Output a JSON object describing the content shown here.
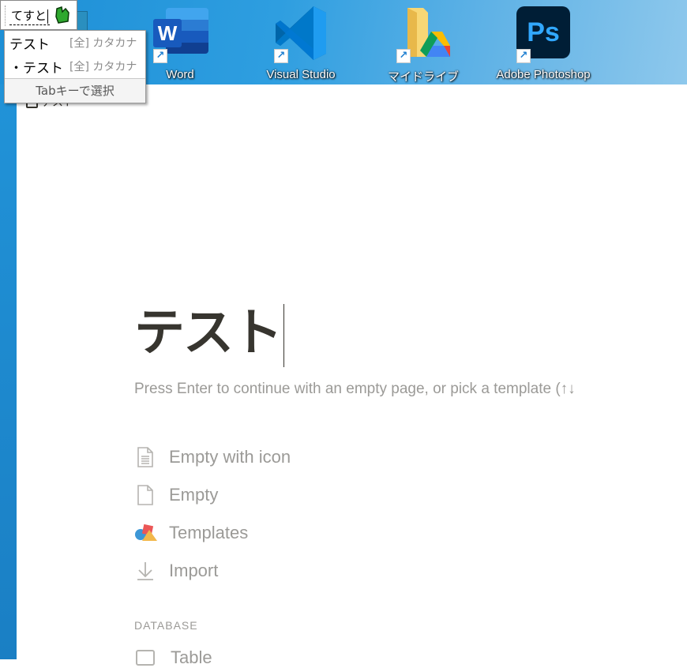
{
  "desktop": {
    "icons": [
      {
        "name": "word",
        "label": "Word",
        "glyph": "W"
      },
      {
        "name": "visual-studio",
        "label": "Visual Studio"
      },
      {
        "name": "my-drive",
        "label": "マイドライブ"
      },
      {
        "name": "adobe-photoshop",
        "label": "Adobe Photoshop",
        "glyph": "Ps"
      }
    ],
    "shortcut_arrow": "↗"
  },
  "ime": {
    "composition": "てすと",
    "candidates": [
      {
        "text": "テスト",
        "meta": "[全] カタカナ"
      },
      {
        "text": "・テスト",
        "meta": "[全] カタカナ"
      }
    ],
    "footer": "Tabキーで選択"
  },
  "page": {
    "breadcrumb": "テスト",
    "breadcrumb_icon": "N",
    "title": "テスト",
    "hint": "Press Enter to continue with an empty page, or pick a template (↑↓",
    "options": [
      {
        "label": "Empty with icon",
        "icon": "page-lines-icon"
      },
      {
        "label": "Empty",
        "icon": "page-icon"
      },
      {
        "label": "Templates",
        "icon": "shapes-icon"
      },
      {
        "label": "Import",
        "icon": "download-icon"
      }
    ],
    "database_label": "DATABASE",
    "database_items": [
      {
        "label": "Table",
        "icon": "table-icon"
      }
    ]
  },
  "colors": {
    "text": "#37352f",
    "muted": "#9b9a97",
    "desktop_blue": "#2e9ee0",
    "word_blue": "#185abd",
    "ps_dark": "#001e36",
    "ps_blue": "#31a8ff"
  }
}
